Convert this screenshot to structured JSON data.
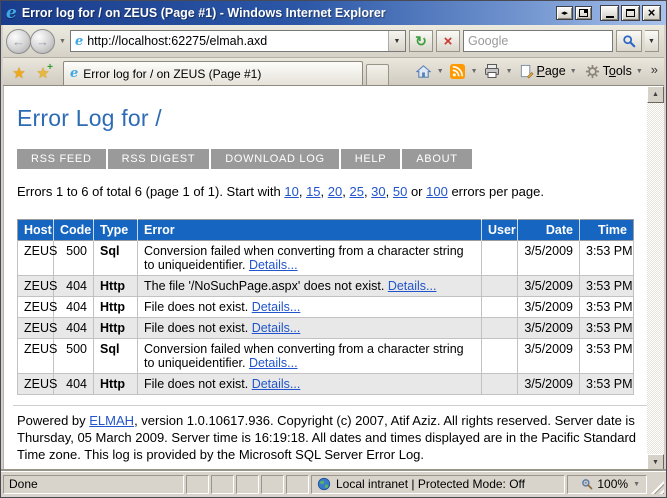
{
  "icons": {
    "back_arrow": "←",
    "forward_arrow": "→",
    "caret": "▼",
    "refresh": "↻",
    "stop": "×",
    "star": "★",
    "plus": "+",
    "chevron_more": "»",
    "close": "×",
    "vm_arrows": "◂▸",
    "scroll_up": "▲",
    "scroll_down": "▼",
    "ie_logo_letter": "e"
  },
  "window": {
    "title": "Error log for / on ZEUS (Page #1) - Windows Internet Explorer"
  },
  "toolbar": {
    "address": "http://localhost:62275/elmah.axd",
    "search_placeholder": "Google"
  },
  "tab_title": "Error log for / on ZEUS (Page #1)",
  "command_bar": {
    "page": {
      "pre": "",
      "accel": "P",
      "post": "age"
    },
    "tools": {
      "pre": "T",
      "accel": "o",
      "post": "ols"
    }
  },
  "page": {
    "heading": "Error Log for /",
    "nav": [
      "RSS FEED",
      "RSS DIGEST",
      "DOWNLOAD LOG",
      "HELP",
      "ABOUT"
    ],
    "pager": {
      "prefix": "Errors 1 to 6 of total 6 (page 1 of 1). Start with ",
      "sizes": [
        "10",
        "15",
        "20",
        "25",
        "30",
        "50",
        "100"
      ],
      "sep": ", ",
      "last_sep": " or ",
      "suffix": " errors per page."
    },
    "table": {
      "headers": [
        "Host",
        "Code",
        "Type",
        "Error",
        "User",
        "Date",
        "Time"
      ],
      "details_label": "Details...",
      "rows": [
        {
          "host": "ZEUS",
          "code": "500",
          "type": "Sql",
          "error": "Conversion failed when converting from a character string to uniqueidentifier.",
          "user": "",
          "date": "3/5/2009",
          "time": "3:53 PM"
        },
        {
          "host": "ZEUS",
          "code": "404",
          "type": "Http",
          "error": "The file '/NoSuchPage.aspx' does not exist.",
          "user": "",
          "date": "3/5/2009",
          "time": "3:53 PM"
        },
        {
          "host": "ZEUS",
          "code": "404",
          "type": "Http",
          "error": "File does not exist.",
          "user": "",
          "date": "3/5/2009",
          "time": "3:53 PM"
        },
        {
          "host": "ZEUS",
          "code": "404",
          "type": "Http",
          "error": "File does not exist.",
          "user": "",
          "date": "3/5/2009",
          "time": "3:53 PM"
        },
        {
          "host": "ZEUS",
          "code": "500",
          "type": "Sql",
          "error": "Conversion failed when converting from a character string to uniqueidentifier.",
          "user": "",
          "date": "3/5/2009",
          "time": "3:53 PM"
        },
        {
          "host": "ZEUS",
          "code": "404",
          "type": "Http",
          "error": "File does not exist.",
          "user": "",
          "date": "3/5/2009",
          "time": "3:53 PM"
        }
      ]
    },
    "footer": {
      "prefix": "Powered by ",
      "link": "ELMAH",
      "rest": ", version 1.0.10617.936. Copyright (c) 2007, Atif Aziz. All rights reserved. Server date is Thursday, 05 March 2009. Server time is 16:19:18. All dates and times displayed are in the Pacific Standard Time zone. This log is provided by the Microsoft SQL Server Error Log."
    }
  },
  "status": {
    "done": "Done",
    "zone": "Local intranet | Protected Mode: Off",
    "zoom": "100%"
  },
  "colors": {
    "table_header_blue": "#1666c1",
    "heading_blue": "#2d6cb5",
    "link_blue": "#2255cc",
    "nav_gray": "#9a9a9a",
    "titlebar_blue": "#2b57a6",
    "feeds_orange": "#ff9900"
  }
}
